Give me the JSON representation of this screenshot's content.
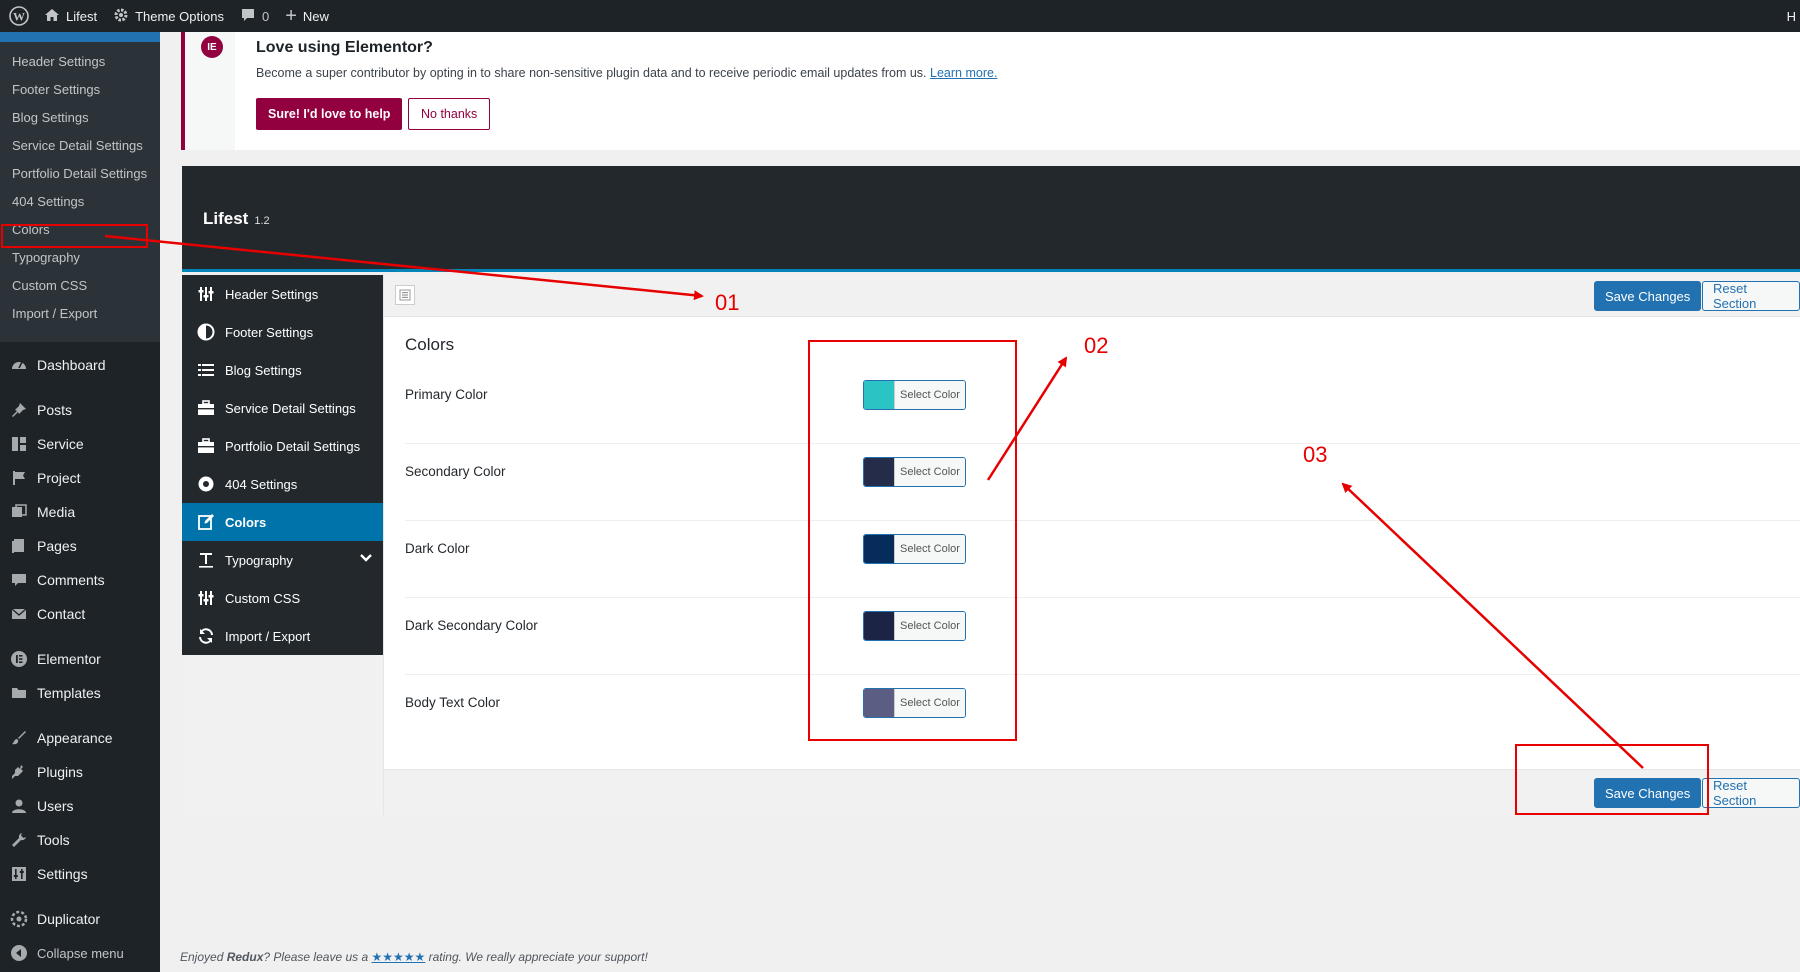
{
  "adminbar": {
    "site_name": "Lifest",
    "theme_options": "Theme Options",
    "comments_count": "0",
    "new_label": "New",
    "right_truncated": "H"
  },
  "submenu": {
    "items": [
      {
        "label": "Header Settings"
      },
      {
        "label": "Footer Settings"
      },
      {
        "label": "Blog Settings"
      },
      {
        "label": "Service Detail Settings"
      },
      {
        "label": "Portfolio Detail Settings"
      },
      {
        "label": "404 Settings"
      },
      {
        "label": "Colors"
      },
      {
        "label": "Typography"
      },
      {
        "label": "Custom CSS"
      },
      {
        "label": "Import / Export"
      }
    ]
  },
  "adminmenu": {
    "dashboard": "Dashboard",
    "posts": "Posts",
    "service": "Service",
    "project": "Project",
    "media": "Media",
    "pages": "Pages",
    "comments": "Comments",
    "contact": "Contact",
    "elementor": "Elementor",
    "templates": "Templates",
    "appearance": "Appearance",
    "plugins": "Plugins",
    "users": "Users",
    "tools": "Tools",
    "settings": "Settings",
    "duplicator": "Duplicator",
    "collapse": "Collapse menu"
  },
  "notice": {
    "title": "Love using Elementor?",
    "text": "Become a super contributor by opting in to share non-sensitive plugin data and to receive periodic email updates from us.",
    "learn_more": "Learn more.",
    "primary_button": "Sure! I'd love to help",
    "secondary_button": "No thanks"
  },
  "redux": {
    "title": "Lifest",
    "version": "1.2",
    "nav": [
      {
        "label": "Header Settings",
        "icon": "sliders-icon"
      },
      {
        "label": "Footer Settings",
        "icon": "contrast-icon"
      },
      {
        "label": "Blog Settings",
        "icon": "list-icon"
      },
      {
        "label": "Service Detail Settings",
        "icon": "briefcase-icon"
      },
      {
        "label": "Portfolio Detail Settings",
        "icon": "briefcase-icon"
      },
      {
        "label": "404 Settings",
        "icon": "gear-icon"
      },
      {
        "label": "Colors",
        "icon": "edit-icon"
      },
      {
        "label": "Typography",
        "icon": "text-icon"
      },
      {
        "label": "Custom CSS",
        "icon": "sliders-icon"
      },
      {
        "label": "Import / Export",
        "icon": "refresh-icon"
      }
    ],
    "save_label": "Save Changes",
    "reset_label": "Reset Section",
    "section_title": "Colors",
    "picker_label": "Select Color",
    "colors": [
      {
        "label": "Primary Color",
        "value": "#2ac4c4"
      },
      {
        "label": "Secondary Color",
        "value": "#252c4a"
      },
      {
        "label": "Dark Color",
        "value": "#062c5c"
      },
      {
        "label": "Dark Secondary Color",
        "value": "#1b2444"
      },
      {
        "label": "Body Text Color",
        "value": "#5b5e82"
      }
    ]
  },
  "footer": {
    "prefix": "Enjoyed ",
    "brand": "Redux",
    "mid": "? Please leave us a ",
    "stars": "★★★★★",
    "suffix": " rating. We really appreciate your support!"
  },
  "annotations": {
    "one": "01",
    "two": "02",
    "three": "03"
  }
}
